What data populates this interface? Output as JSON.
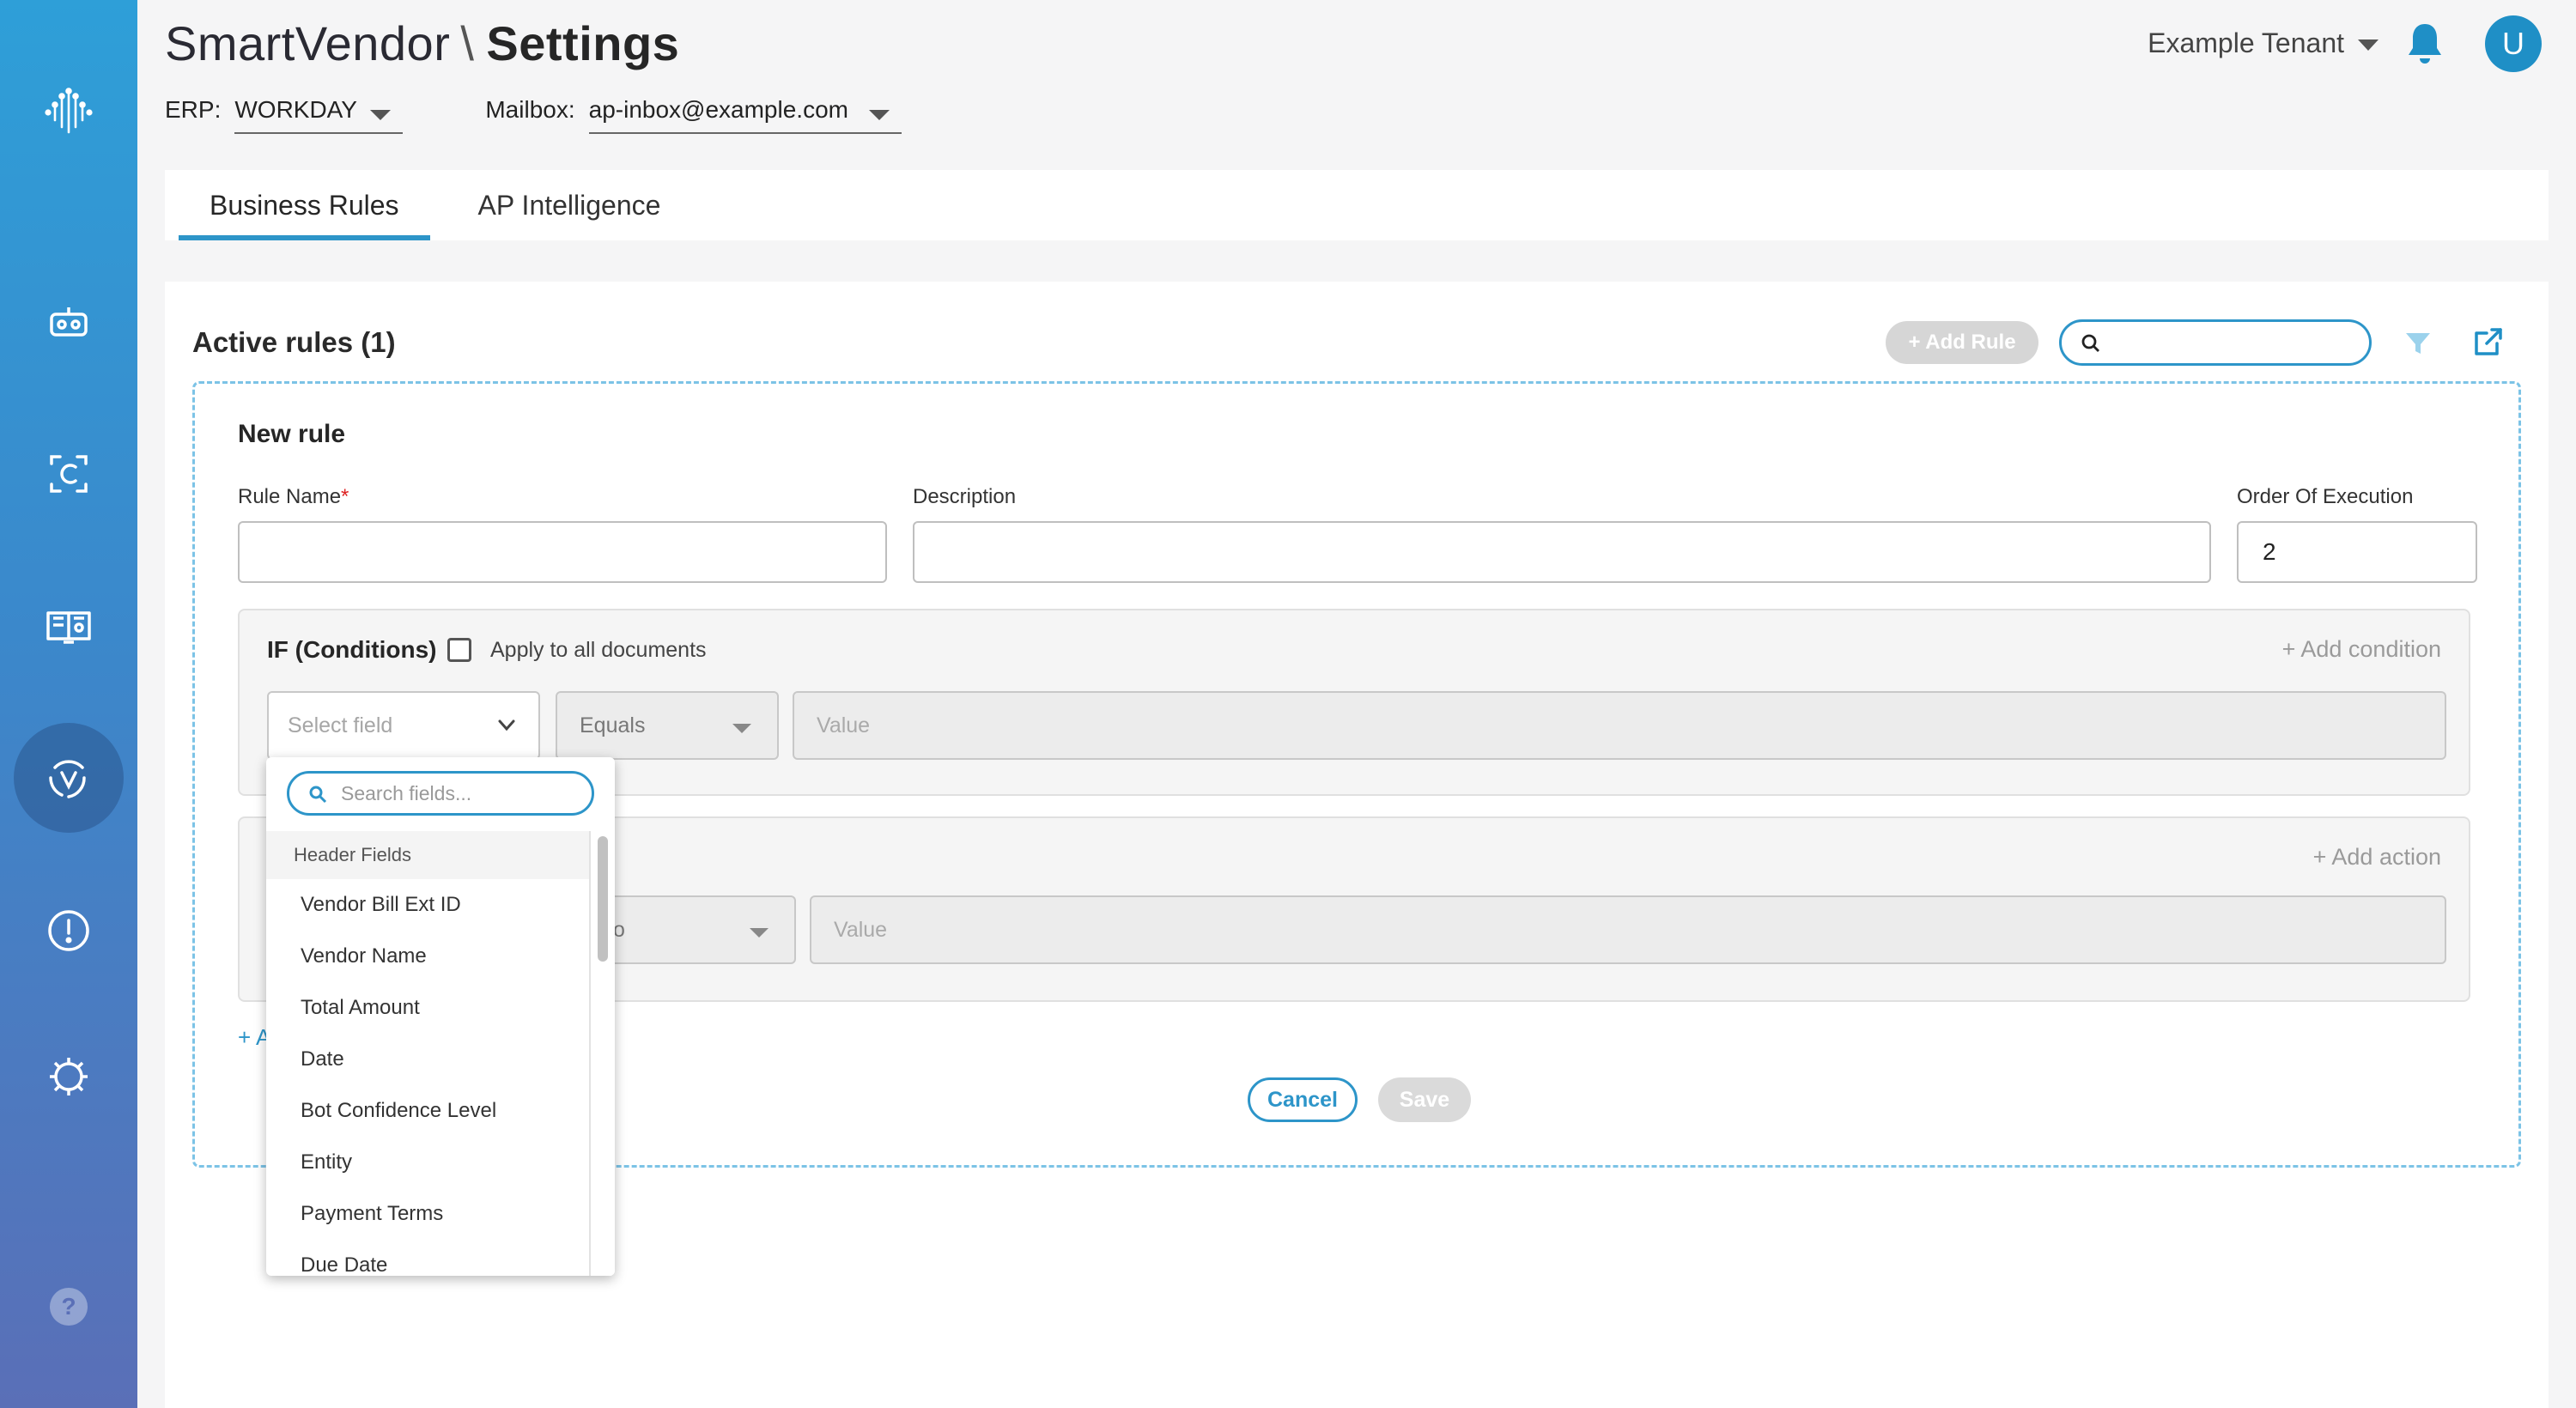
{
  "header": {
    "app_name": "SmartVendor",
    "separator": "\\",
    "page_title": "Settings",
    "erp_label": "ERP:",
    "erp_value": "WORKDAY",
    "mailbox_label": "Mailbox:",
    "mailbox_value": "ap-inbox@example.com",
    "tenant": "Example Tenant",
    "avatar_initial": "U"
  },
  "sidebar": {
    "items": [
      {
        "icon": "logo-icon"
      },
      {
        "icon": "robot-icon"
      },
      {
        "icon": "c-frame-icon"
      },
      {
        "icon": "book-icon"
      },
      {
        "icon": "v-cycle-icon",
        "active": true
      },
      {
        "icon": "alert-circle-icon"
      },
      {
        "icon": "gear-icon"
      },
      {
        "icon": "help-icon"
      }
    ]
  },
  "tabs": [
    {
      "label": "Business Rules",
      "active": true
    },
    {
      "label": "AP Intelligence",
      "active": false
    }
  ],
  "rules": {
    "heading": "Active rules (1)",
    "add_rule_label": "+ Add Rule",
    "search_value": ""
  },
  "form": {
    "title": "New rule",
    "rule_name_label": "Rule Name",
    "required_mark": "*",
    "rule_name_value": "",
    "description_label": "Description",
    "description_value": "",
    "order_label": "Order Of Execution",
    "order_value": "2",
    "conditions_title": "IF (Conditions)",
    "apply_all_label": "Apply to all documents",
    "add_condition_label": "+ Add condition",
    "select_field_placeholder": "Select field",
    "operator_value": "Equals",
    "value_placeholder": "Value",
    "add_action_label": "+ Add action",
    "action_operator_value": "to",
    "action_value_placeholder": "Value",
    "add_below_label": "+ A",
    "cancel_label": "Cancel",
    "save_label": "Save"
  },
  "dropdown": {
    "search_placeholder": "Search fields...",
    "group_label": "Header Fields",
    "items": [
      "Vendor Bill Ext ID",
      "Vendor Name",
      "Total Amount",
      "Date",
      "Bot Confidence Level",
      "Entity",
      "Payment Terms",
      "Due Date"
    ]
  },
  "colors": {
    "accent": "#2d95c9",
    "sidebar_top": "#2e9fd8",
    "sidebar_bottom": "#5a6fb7"
  }
}
